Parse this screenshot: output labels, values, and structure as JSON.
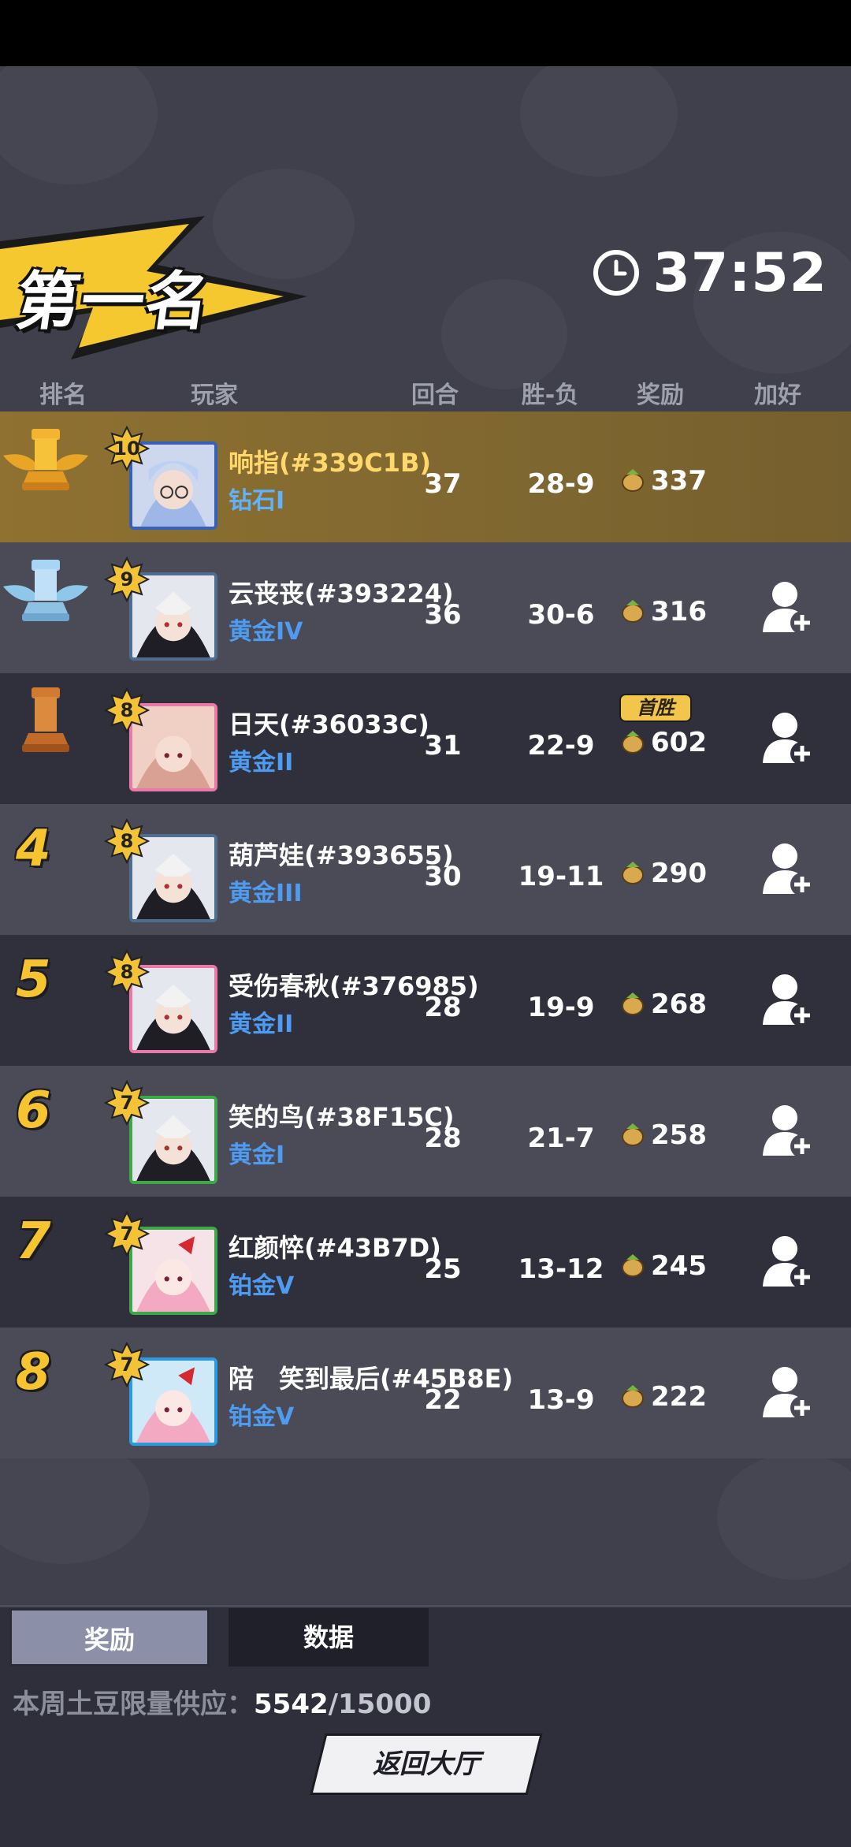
{
  "header": {
    "title": "第一名",
    "timer": "37:52",
    "clock_icon": "clock-icon"
  },
  "columns": {
    "rank": "排名",
    "player": "玩家",
    "rounds": "回合",
    "record": "胜-负",
    "reward": "奖励",
    "add_friend": "加好友"
  },
  "players": [
    {
      "rank": "1",
      "level": "10",
      "name": "响指(#339C1B)",
      "tier": "钻石I",
      "rounds": "37",
      "record": "28-9",
      "reward": "337",
      "first_win": "",
      "self": true
    },
    {
      "rank": "2",
      "level": "9",
      "name": "云丧丧(#393224)",
      "tier": "黄金IV",
      "rounds": "36",
      "record": "30-6",
      "reward": "316",
      "first_win": ""
    },
    {
      "rank": "3",
      "level": "8",
      "name": "日天(#36033C)",
      "tier": "黄金II",
      "rounds": "31",
      "record": "22-9",
      "reward": "602",
      "first_win": "首胜"
    },
    {
      "rank": "4",
      "level": "8",
      "name": "葫芦娃(#393655)",
      "tier": "黄金III",
      "rounds": "30",
      "record": "19-11",
      "reward": "290",
      "first_win": ""
    },
    {
      "rank": "5",
      "level": "8",
      "name": "受伤春秋(#376985)",
      "tier": "黄金II",
      "rounds": "28",
      "record": "19-9",
      "reward": "268",
      "first_win": ""
    },
    {
      "rank": "6",
      "level": "7",
      "name": "笑的鸟(#38F15C)",
      "tier": "黄金I",
      "rounds": "28",
      "record": "21-7",
      "reward": "258",
      "first_win": ""
    },
    {
      "rank": "7",
      "level": "7",
      "name": "红颜悴(#43B7D)",
      "tier": "铂金V",
      "rounds": "25",
      "record": "13-12",
      "reward": "245",
      "first_win": ""
    },
    {
      "rank": "8",
      "level": "7",
      "name": "陪　笑到最后(#45B8E)",
      "tier": "铂金V",
      "rounds": "22",
      "record": "13-9",
      "reward": "222",
      "first_win": ""
    }
  ],
  "tabs": {
    "reward": "奖励",
    "data": "数据"
  },
  "supply": {
    "label": "本周土豆限量供应：",
    "current": "5542",
    "max": "/15000"
  },
  "return_button": "返回大厅",
  "colors": {
    "gold": "#f6c431",
    "tier_blue": "#4e9bf2",
    "first_row": "#8f7131",
    "background": "#3f404b"
  }
}
